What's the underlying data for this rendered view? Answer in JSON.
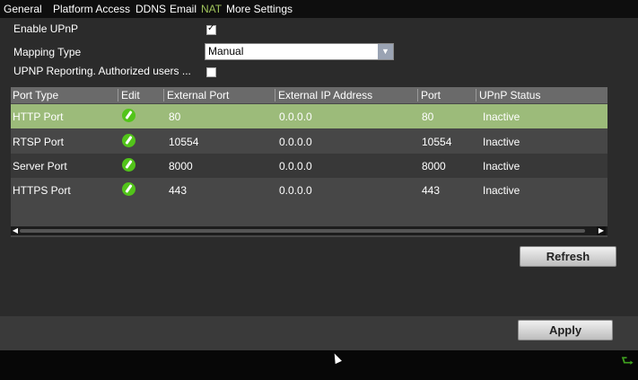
{
  "tabs": [
    "General",
    "Platform Access",
    "DDNS",
    "Email",
    "NAT",
    "More Settings"
  ],
  "active_tab": "NAT",
  "enable_upnp": {
    "label": "Enable UPnP",
    "checked": true
  },
  "mapping_type": {
    "label": "Mapping Type",
    "value": "Manual"
  },
  "upnp_reporting": {
    "label": "UPNP Reporting. Authorized users ...",
    "checked": false
  },
  "table": {
    "columns": [
      "Port Type",
      "Edit",
      "External Port",
      "External IP Address",
      "Port",
      "UPnP Status"
    ],
    "rows": [
      {
        "type": "HTTP Port",
        "external_port": "80",
        "external_ip": "0.0.0.0",
        "port": "80",
        "status": "Inactive",
        "selected": true
      },
      {
        "type": "RTSP Port",
        "external_port": "10554",
        "external_ip": "0.0.0.0",
        "port": "10554",
        "status": "Inactive"
      },
      {
        "type": "Server Port",
        "external_port": "8000",
        "external_ip": "0.0.0.0",
        "port": "8000",
        "status": "Inactive"
      },
      {
        "type": "HTTPS Port",
        "external_port": "443",
        "external_ip": "0.0.0.0",
        "port": "443",
        "status": "Inactive"
      }
    ]
  },
  "buttons": {
    "refresh": "Refresh",
    "apply": "Apply"
  },
  "icons": {
    "edit": "edit-icon",
    "back": "back-arrow-icon",
    "cursor": "mouse-cursor-icon"
  },
  "colors": {
    "active_tab": "#9fc35b",
    "selected_row": "#9cbb7a",
    "edit_icon": "#52c41a",
    "back_icon": "#3f9f1f"
  }
}
